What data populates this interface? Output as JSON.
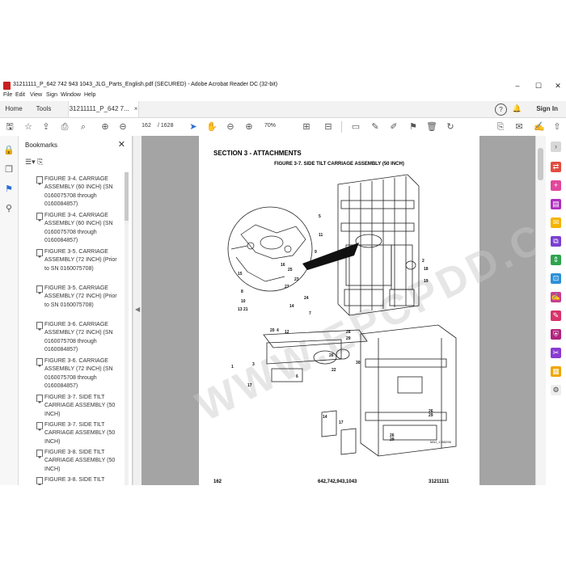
{
  "window": {
    "title": "31211111_P_642 742 943 1043_JLG_Parts_English.pdf (SECURED) - Adobe Acrobat Reader DC (32-bit)",
    "minimize": "–",
    "maximize": "☐",
    "close": "✕"
  },
  "menu": [
    "File",
    "Edit",
    "View",
    "Sign",
    "Window",
    "Help"
  ],
  "tabs": {
    "home": "Home",
    "tools": "Tools",
    "document": "31211111_P_642 7...",
    "close": "×",
    "help": "?",
    "bell": "🔔",
    "signin": "Sign In"
  },
  "toolbar": {
    "page_current": "162",
    "page_total": "/ 1628",
    "zoom": "70%"
  },
  "bookmarks": {
    "header": "Bookmarks",
    "close": "✕",
    "options": "☰▾ ⎘",
    "items": [
      "FIGURE 3-4. CARRIAGE ASSEMBLY (60 INCH) (SN 0160075708 through 0160084857)",
      "FIGURE 3-4. CARRIAGE ASSEMBLY (60 INCH) (SN 0160075708 through 0160084857)",
      "FIGURE 3-5. CARRIAGE ASSEMBLY (72 INCH) (Prior to SN 0160075708)",
      "FIGURE 3-5. CARRIAGE ASSEMBLY (72 INCH) (Prior to SN 0160075708)",
      "FIGURE 3-6. CARRIAGE ASSEMBLY (72 INCH) (SN 0160075708 through 0160084857)",
      "FIGURE 3-6. CARRIAGE ASSEMBLY (72 INCH) (SN 0160075708 through 0160084857)",
      "FIGURE 3-7. SIDE TILT CARRIAGE ASSEMBLY (50 INCH)",
      "FIGURE 3-7. SIDE TILT CARRIAGE ASSEMBLY (50 INCH)",
      "FIGURE 3-8. SIDE TILT CARRIAGE ASSEMBLY (50 INCH)",
      "FIGURE 3-8. SIDE TILT"
    ]
  },
  "page": {
    "section": "SECTION 3 - ATTACHMENTS",
    "figure_title": "FIGURE 3-7. SIDE TILT CARRIAGE ASSEMBLY (50 INCH)",
    "footer_left": "162",
    "footer_center": "642,742,943,1043",
    "footer_right": "31211111",
    "watermark": "WWW.EPCPDD.COM",
    "drawing_code": "MAJ_1785296",
    "callouts": [
      "5",
      "11",
      "9",
      "2",
      "18",
      "19",
      "15",
      "16",
      "25",
      "23",
      "27",
      "8",
      "10",
      "24",
      "14",
      "21",
      "13",
      "4",
      "20",
      "3",
      "7",
      "12",
      "1",
      "26",
      "22",
      "17",
      "6",
      "28",
      "29",
      "30"
    ]
  },
  "colors": {
    "pdf_icon": "#c8201f",
    "doc_bg": "#a4a4a4"
  }
}
